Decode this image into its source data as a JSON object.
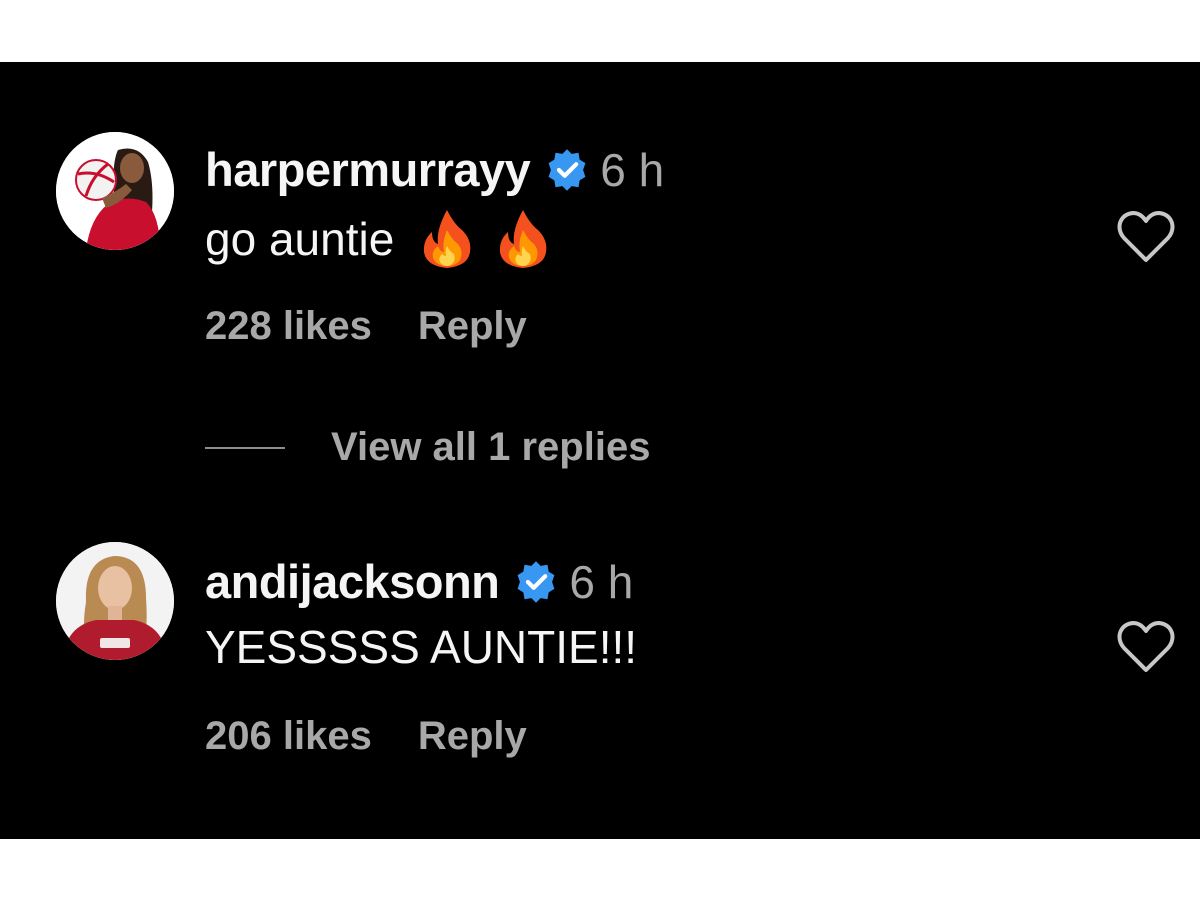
{
  "comments": [
    {
      "username": "harpermurrayy",
      "verified_icon": "verified-badge-icon",
      "time": "6 h",
      "text": "go auntie",
      "emojis": [
        "fire-emoji",
        "fire-emoji"
      ],
      "likes": "228 likes",
      "reply_label": "Reply",
      "like_icon": "heart-outline-icon"
    },
    {
      "username": "andijacksonn",
      "verified_icon": "verified-badge-icon",
      "time": "6 h",
      "text": "YESSSSS AUNTIE!!!",
      "emojis": [],
      "likes": "206 likes",
      "reply_label": "Reply",
      "like_icon": "heart-outline-icon"
    }
  ],
  "view_replies": {
    "label": "View all 1 replies"
  },
  "colors": {
    "background": "#000000",
    "primary_text": "#f5f5f5",
    "secondary_text": "#a8a8a8",
    "verified_blue": "#3897f0"
  }
}
